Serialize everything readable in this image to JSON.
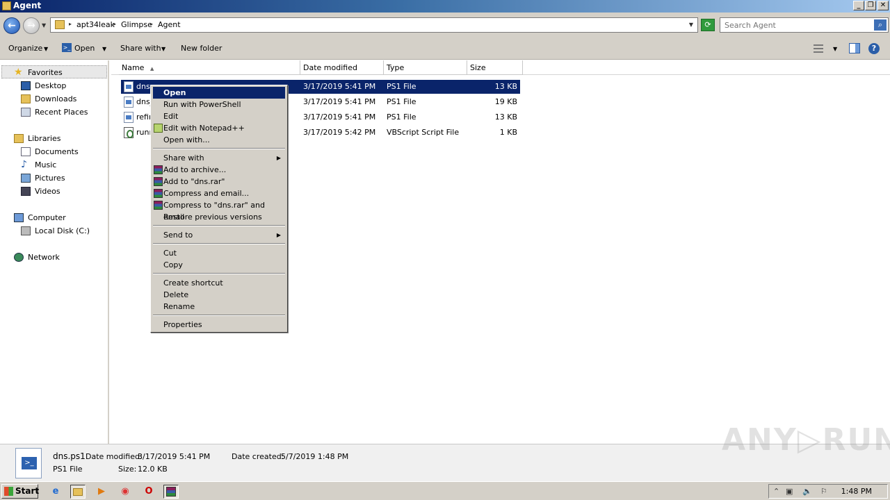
{
  "window": {
    "title": "Agent",
    "controls": [
      "_",
      "❐",
      "✕"
    ]
  },
  "address": {
    "crumbs": [
      "apt34leak",
      "Glimpse",
      "Agent"
    ],
    "search_placeholder": "Search Agent"
  },
  "toolbar": {
    "organize": "Organize",
    "open": "Open",
    "share_with": "Share with",
    "new_folder": "New folder"
  },
  "nav": {
    "favorites": "Favorites",
    "desktop": "Desktop",
    "downloads": "Downloads",
    "recent_places": "Recent Places",
    "libraries": "Libraries",
    "documents": "Documents",
    "music": "Music",
    "pictures": "Pictures",
    "videos": "Videos",
    "computer": "Computer",
    "local_disk": "Local Disk (C:)",
    "network": "Network"
  },
  "columns": {
    "name": "Name",
    "date_modified": "Date modified",
    "type": "Type",
    "size": "Size"
  },
  "files": [
    {
      "name": "dns.",
      "date": "3/17/2019 5:41 PM",
      "type": "PS1 File",
      "size": "13 KB"
    },
    {
      "name": "dns_",
      "date": "3/17/2019 5:41 PM",
      "type": "PS1 File",
      "size": "19 KB"
    },
    {
      "name": "refin",
      "date": "3/17/2019 5:41 PM",
      "type": "PS1 File",
      "size": "13 KB"
    },
    {
      "name": "runn",
      "date": "3/17/2019 5:42 PM",
      "type": "VBScript Script File",
      "size": "1 KB"
    }
  ],
  "context_menu": {
    "open": "Open",
    "run_powershell": "Run with PowerShell",
    "edit": "Edit",
    "edit_notepadpp": "Edit with Notepad++",
    "open_with": "Open with...",
    "share_with": "Share with",
    "add_archive": "Add to archive...",
    "add_dns_rar": "Add to \"dns.rar\"",
    "compress_email": "Compress and email...",
    "compress_dns_email": "Compress to \"dns.rar\" and email",
    "restore_versions": "Restore previous versions",
    "send_to": "Send to",
    "cut": "Cut",
    "copy": "Copy",
    "create_shortcut": "Create shortcut",
    "delete": "Delete",
    "rename": "Rename",
    "properties": "Properties"
  },
  "details": {
    "filename": "dns.ps1",
    "date_modified_label": "Date modified:",
    "date_modified": "3/17/2019 5:41 PM",
    "date_created_label": "Date created:",
    "date_created": "5/7/2019 1:48 PM",
    "type": "PS1 File",
    "size_label": "Size:",
    "size": "12.0 KB"
  },
  "watermark": "ANY▷RUN",
  "taskbar": {
    "start": "Start",
    "clock": "1:48 PM"
  }
}
